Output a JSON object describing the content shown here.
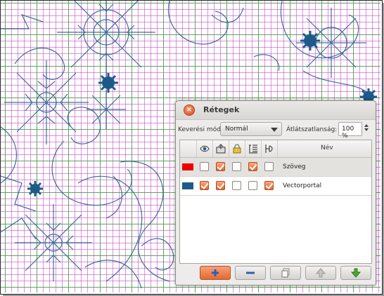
{
  "dialog": {
    "title": "Rétegek",
    "blend_label": "Keverési mód:",
    "blend_value": "Normál",
    "opacity_label": "Átlátszatlanság:",
    "opacity_value": "100 %"
  },
  "table": {
    "name_header": "Név",
    "header_icons": [
      "eye-icon",
      "lock-edit-icon",
      "padlock-icon",
      "text-outline-icon",
      "merge-icon"
    ],
    "rows": [
      {
        "name": "Szöveg",
        "color": "#ee0000",
        "visible": false,
        "editable": true,
        "locked": false,
        "outline": true,
        "merge": false
      },
      {
        "name": "Vectorportal",
        "color": "#1d5a8a",
        "visible": true,
        "editable": true,
        "locked": false,
        "outline": false,
        "merge": true
      }
    ]
  },
  "buttons": [
    "add-layer-button",
    "remove-layer-button",
    "duplicate-layer-button",
    "move-up-button",
    "move-down-button"
  ],
  "colors": {
    "accent": "#e5692f",
    "decor": "#1d5a8a",
    "grid": "#3caa3c",
    "dots": "#be3cbe"
  }
}
